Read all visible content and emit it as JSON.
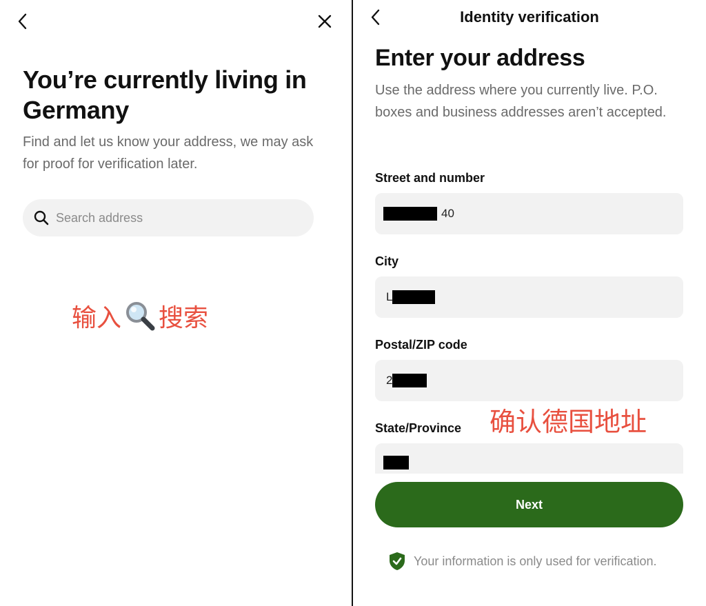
{
  "left": {
    "title": "You’re currently living in Germany",
    "subtitle": "Find and let us know your address, we may ask for proof for verification later.",
    "search": {
      "placeholder": "Search address",
      "value": ""
    },
    "annotation": {
      "before": "输入",
      "after": "搜索"
    }
  },
  "right": {
    "header": "Identity verification",
    "title": "Enter your address",
    "subtitle": "Use the address where you currently live. P.O. boxes and business addresses aren’t accepted.",
    "fields": [
      {
        "label": "Street and number",
        "visible": "40"
      },
      {
        "label": "City",
        "visible": "L"
      },
      {
        "label": "Postal/ZIP code",
        "visible": "2"
      },
      {
        "label": "State/Province",
        "visible": ""
      }
    ],
    "annotation": "确认德国地址",
    "next_label": "Next",
    "footer_note": "Your information is only used for verification."
  },
  "colors": {
    "accent_green": "#2b6a1b",
    "annotation_red": "#e8503f",
    "field_bg": "#f2f2f2",
    "muted_text": "#6a6a6a"
  },
  "icons": [
    "back-icon",
    "close-icon",
    "search-icon",
    "magnifier-emoji-icon",
    "shield-check-icon"
  ]
}
